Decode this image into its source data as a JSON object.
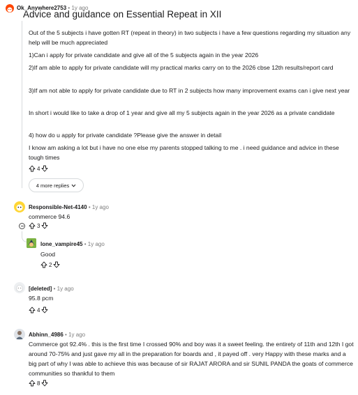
{
  "post": {
    "author": "Ok_Anywhere2753",
    "age": "1y ago",
    "title": "Advice and guidance on Essential Repeat in XII",
    "paragraphs": [
      "Out of the 5 subjects i have gotten RT (repeat in theory) in two subjects i have a few questions regarding my situation any help will be much appreciated",
      "1)Can i apply for private candidate and give all of the 5 subjects again in the year 2026",
      "2)If am able to apply for private candidate will my practical marks carry on to the 2026 cbse 12th results/report card",
      "3)If am not able to apply for private candidate due to RT in 2 subjects how many improvement exams can i give next year",
      "In short i would like to take a drop of 1 year and give all my 5 subjects again in the year 2026 as a private candidate",
      "4) how do u apply for private candidate ?Please give the answer in detail",
      "I know am asking a lot but i have no one else my parents stopped talking to me . i need guidance and advice in these tough times"
    ],
    "votes": "4",
    "more_replies": "4 more replies"
  },
  "comments": [
    {
      "author": "Responsible-Net-4140",
      "age": "1y ago",
      "text": "commerce 94.6",
      "votes": "3"
    },
    {
      "author": "lone_vampire45",
      "age": "1y ago",
      "text": "Good",
      "votes": "2"
    },
    {
      "author": "[deleted]",
      "age": "1y ago",
      "text": "95.8 pcm",
      "votes": "4"
    },
    {
      "author": "Abhinn_4986",
      "age": "1y ago",
      "text": "Commerce got 92.4% . this is the first time I crossed 90% and boy was it a sweet feeling. the entirety of 11th and 12th I got around 70-75% and just gave my all in the preparation for boards and , it payed off . very Happy with these marks and a big part of why I was able to achieve this was because of sir RAJAT ARORA and sir SUNIL PANDA the goats of commerce communities so thankful to them",
      "votes": "8"
    }
  ],
  "separator": "•",
  "colors": {
    "text": "#1a1a1b",
    "muted": "#7c7c7c",
    "line": "#d7dadc"
  },
  "icons": [
    "upvote-icon",
    "downvote-icon",
    "chevron-down-icon",
    "collapse-icon"
  ]
}
